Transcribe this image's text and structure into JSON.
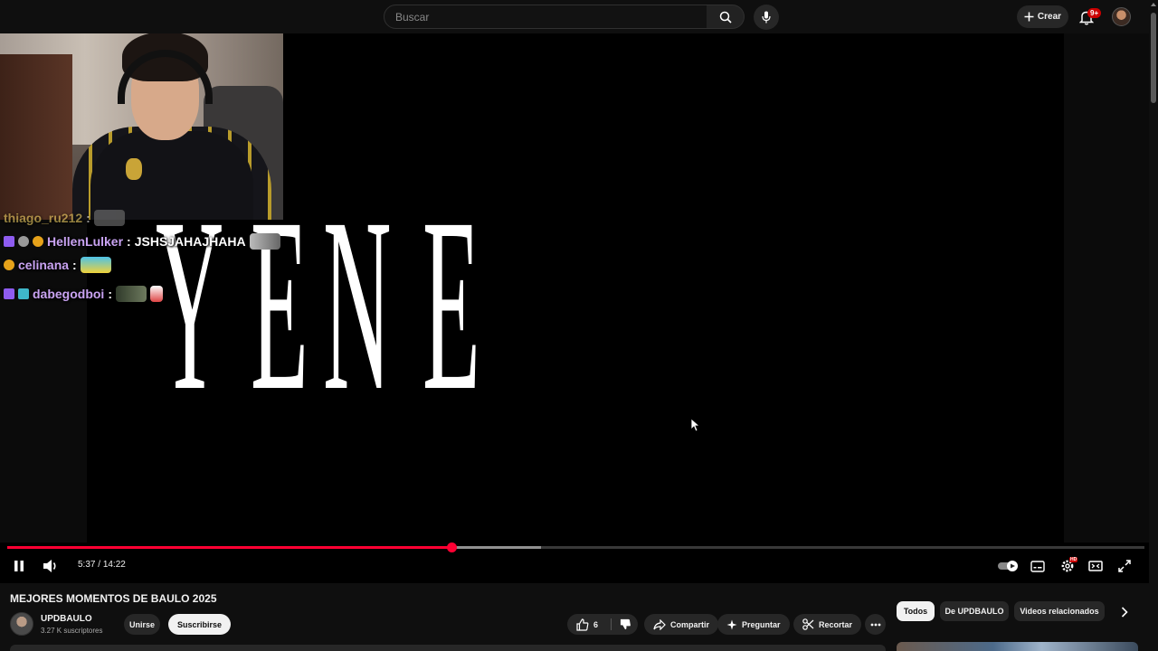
{
  "masthead": {
    "search_placeholder": "Buscar",
    "create_label": "Crear",
    "notifications_badge": "9+"
  },
  "player": {
    "overlay_text": [
      "Y",
      "E",
      "N",
      "E"
    ],
    "chat": [
      {
        "user": "thiago_ru212",
        "separator": " :",
        "message": ""
      },
      {
        "user": "HellenLulker",
        "separator": " :",
        "message": "JSHSJAHAJHAHA"
      },
      {
        "user": "celinana",
        "separator": " :",
        "message": ""
      },
      {
        "user": "dabegodboi",
        "separator": " :",
        "message": ""
      }
    ],
    "time_current": "5:37",
    "time_separator": " / ",
    "time_total": "14:22",
    "progress_played_fraction": 0.391,
    "progress_buffered_fraction": 0.469,
    "settings_badge": "HD"
  },
  "video": {
    "title": "MEJORES MOMENTOS DE BAULO 2025",
    "channel_name": "UPDBAULO",
    "subscribers": "3.27 K suscriptores",
    "join_label": "Unirse",
    "subscribe_label": "Suscribirse",
    "like_count": "6",
    "share_label": "Compartir",
    "ask_label": "Preguntar",
    "clip_label": "Recortar"
  },
  "chips": [
    "Todos",
    "De UPDBAULO",
    "Videos relacionados"
  ],
  "colors": {
    "accent_red": "#ff0033",
    "background": "#0f0f0f",
    "pill": "#272727",
    "chat_purple": "#c9a3f2",
    "chat_yellow": "#f1d063"
  }
}
